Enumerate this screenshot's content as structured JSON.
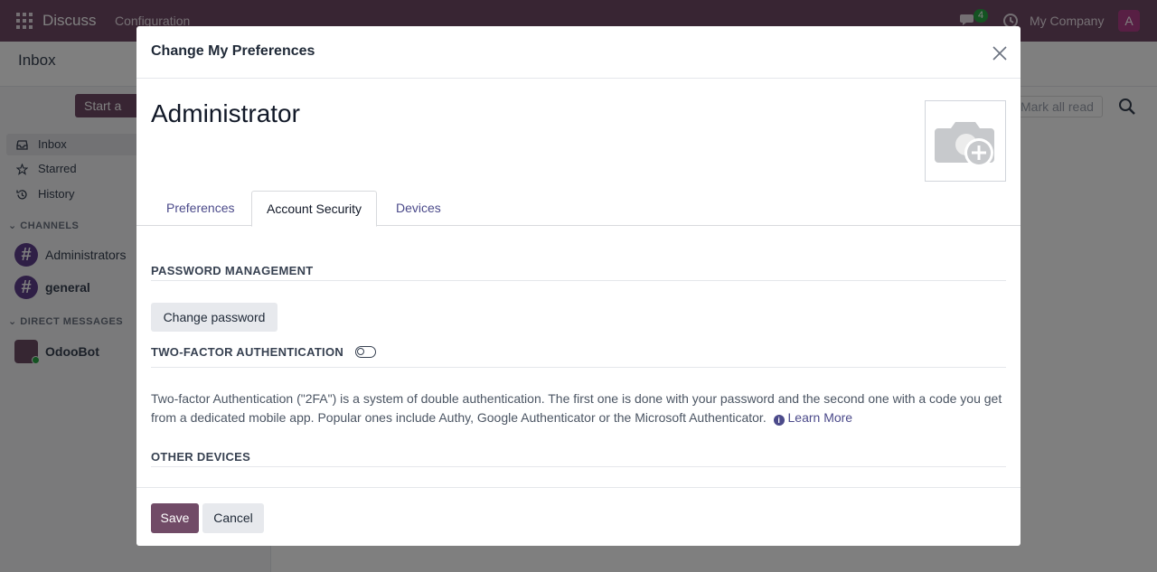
{
  "topbar": {
    "app_name": "Discuss",
    "menu_configuration": "Configuration",
    "chat_badge": "4",
    "company": "My Company",
    "avatar_letter": "A"
  },
  "controlpanel": {
    "title": "Inbox",
    "mark_all_read": "Mark all read"
  },
  "sidebar": {
    "start_button": "Start a",
    "items": [
      {
        "label": "Inbox",
        "icon": "inbox-icon"
      },
      {
        "label": "Starred",
        "icon": "star-icon"
      },
      {
        "label": "History",
        "icon": "history-icon"
      }
    ],
    "channels_header": "CHANNELS",
    "channels": [
      "Administrators",
      "general"
    ],
    "dm_header": "DIRECT MESSAGES",
    "direct_messages": [
      "OdooBot"
    ]
  },
  "modal": {
    "title": "Change My Preferences",
    "record_name": "Administrator",
    "tabs": [
      "Preferences",
      "Account Security",
      "Devices"
    ],
    "active_tab": "Account Security",
    "password_section": "PASSWORD MANAGEMENT",
    "change_password": "Change password",
    "twofa_section": "TWO-FACTOR AUTHENTICATION",
    "twofa_description": "Two-factor Authentication (\"2FA\") is a system of double authentication. The first one is done with your password and the second one with a code you get from a dedicated mobile app. Popular ones include Authy, Google Authenticator or the Microsoft Authenticator.",
    "learn_more": "Learn More",
    "other_devices_section": "OTHER DEVICES",
    "save": "Save",
    "cancel": "Cancel"
  },
  "colors": {
    "brand": "#714b67",
    "link": "#4b4a8a"
  }
}
